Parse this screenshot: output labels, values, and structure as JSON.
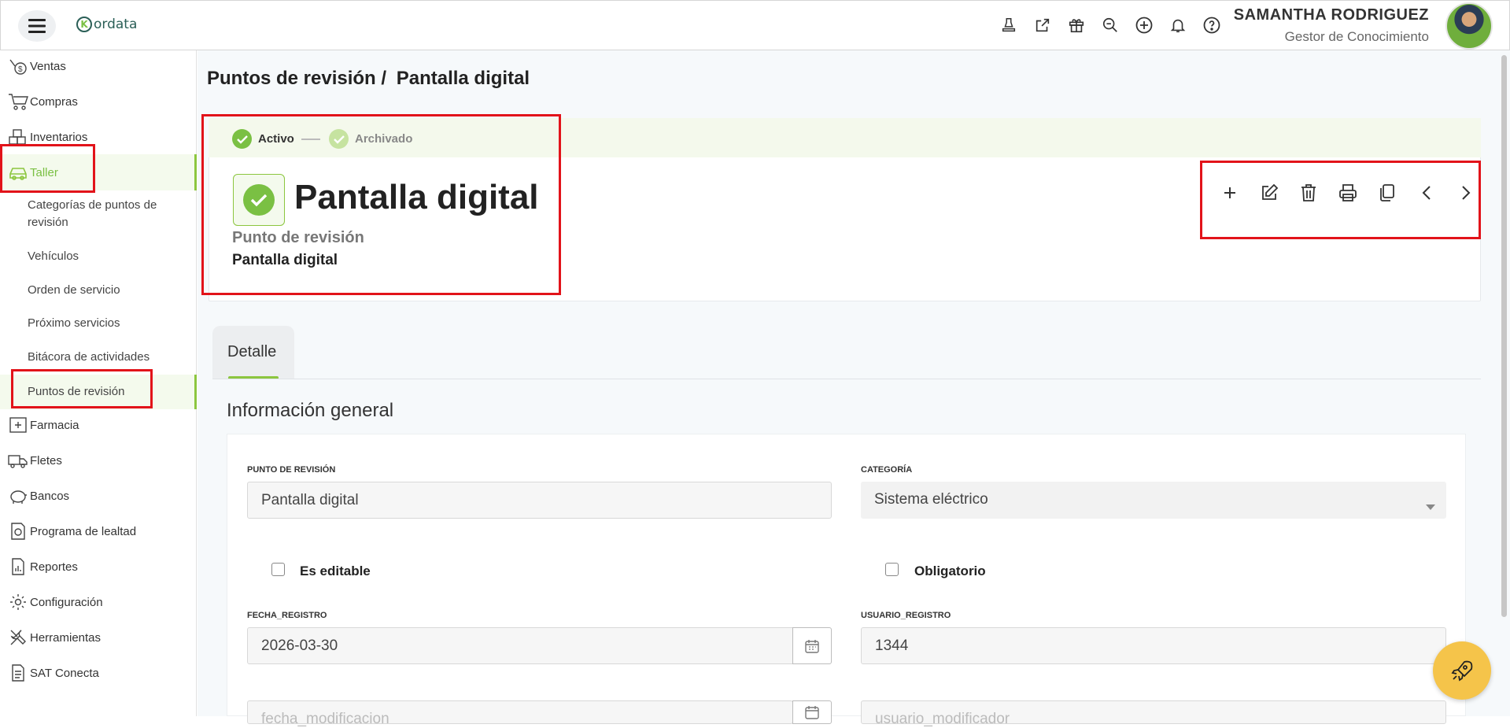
{
  "header": {
    "logo_text": "ordata",
    "logo_letter": "K",
    "user_name": "SAMANTHA RODRIGUEZ",
    "user_role": "Gestor de Conocimiento",
    "icons": [
      "stamp-icon",
      "external-link-icon",
      "gift-icon",
      "search-zoom-icon",
      "plus-circle-icon",
      "bell-icon",
      "help-icon"
    ]
  },
  "sidebar": {
    "items": [
      {
        "label": "Ventas",
        "icon": "sales-icon"
      },
      {
        "label": "Compras",
        "icon": "cart-icon"
      },
      {
        "label": "Inventarios",
        "icon": "inventory-icon"
      },
      {
        "label": "Taller",
        "icon": "car-icon",
        "active": true
      },
      {
        "label": "Farmacia",
        "icon": "pharmacy-icon"
      },
      {
        "label": "Fletes",
        "icon": "truck-icon"
      },
      {
        "label": "Bancos",
        "icon": "piggy-bank-icon"
      },
      {
        "label": "Programa de lealtad",
        "icon": "loyalty-icon"
      },
      {
        "label": "Reportes",
        "icon": "report-icon"
      },
      {
        "label": "Configuración",
        "icon": "gear-icon"
      },
      {
        "label": "Herramientas",
        "icon": "tools-icon"
      },
      {
        "label": "SAT Conecta",
        "icon": "document-icon"
      }
    ],
    "subitems": [
      {
        "label": "Categorías de puntos de revisión"
      },
      {
        "label": "Vehículos"
      },
      {
        "label": "Orden de servicio"
      },
      {
        "label": "Próximo servicios"
      },
      {
        "label": "Bitácora de actividades"
      },
      {
        "label": "Puntos de revisión",
        "active": true
      }
    ]
  },
  "breadcrumb": {
    "parent": "Puntos de revisión /",
    "current": "Pantalla digital"
  },
  "status": {
    "active": "Activo",
    "archived": "Archivado"
  },
  "record": {
    "title": "Pantalla digital",
    "type_label": "Punto de revisión",
    "type_value": "Pantalla digital"
  },
  "actions": [
    "add-icon",
    "edit-icon",
    "delete-icon",
    "print-icon",
    "copy-icon",
    "previous-icon",
    "next-icon"
  ],
  "tabs": [
    {
      "label": "Detalle",
      "active": true
    }
  ],
  "section_title": "Información general",
  "form": {
    "punto_label": "PUNTO DE REVISIÓN",
    "punto_value": "Pantalla digital",
    "categoria_label": "CATEGORÍA",
    "categoria_value": "Sistema eléctrico",
    "editable_label": "Es editable",
    "obligatorio_label": "Obligatorio",
    "fecha_label": "FECHA_REGISTRO",
    "fecha_value": "2026-03-30",
    "usuario_label": "USUARIO_REGISTRO",
    "usuario_value": "1344",
    "fecha_mod_placeholder": "fecha_modificacion",
    "usuario_mod_placeholder": "usuario_modificador"
  },
  "colors": {
    "accent": "#8cc63f",
    "highlight": "#e2131a",
    "fab": "#f5c44a"
  }
}
